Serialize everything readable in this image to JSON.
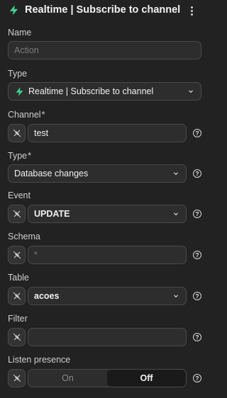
{
  "header": {
    "icon": "bolt-icon",
    "title": "Realtime | Subscribe to channel",
    "accent": "#3ecf8e"
  },
  "fields": {
    "name": {
      "label": "Name",
      "placeholder": "Action",
      "value": ""
    },
    "type": {
      "label": "Type",
      "value": "Realtime | Subscribe to channel"
    },
    "channel": {
      "label": "Channel",
      "required": "*",
      "value": "test"
    },
    "type2": {
      "label": "Type",
      "required": "*",
      "value": "Database changes"
    },
    "event": {
      "label": "Event",
      "value": "UPDATE"
    },
    "schema": {
      "label": "Schema",
      "placeholder": "*",
      "value": ""
    },
    "table": {
      "label": "Table",
      "value": "acoes"
    },
    "filter": {
      "label": "Filter",
      "value": ""
    },
    "listen_presence": {
      "label": "Listen presence",
      "options": [
        "On",
        "Off"
      ],
      "selected": "Off"
    }
  },
  "icons": {
    "binding": "unlink-icon",
    "help": "help-circle-icon",
    "chevron": "chevron-down-icon",
    "more": "more-vertical-icon"
  },
  "help_glyph": "?"
}
